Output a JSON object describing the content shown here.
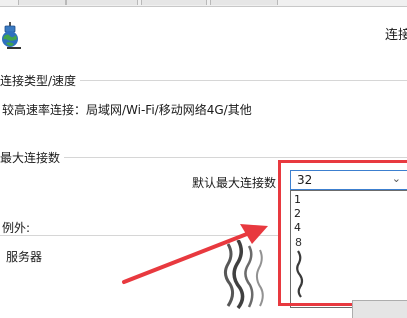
{
  "header": {
    "right_label": "连接"
  },
  "connection_type": {
    "title": "连接类型/速度",
    "value": "较高速率连接：局域网/Wi-Fi/移动网络4G/其他"
  },
  "max_connections": {
    "title": "最大连接数",
    "default_label": "默认最大连接数",
    "selected": "32",
    "options": [
      "1",
      "2",
      "4",
      "8"
    ]
  },
  "exceptions": {
    "label": "例外:",
    "item": "服务器"
  },
  "icons": {
    "app": "network-globe-icon",
    "dropdown": "chevron-down-icon"
  },
  "colors": {
    "highlight": "#e8393f",
    "dropdown_border": "#3c7fcf"
  }
}
